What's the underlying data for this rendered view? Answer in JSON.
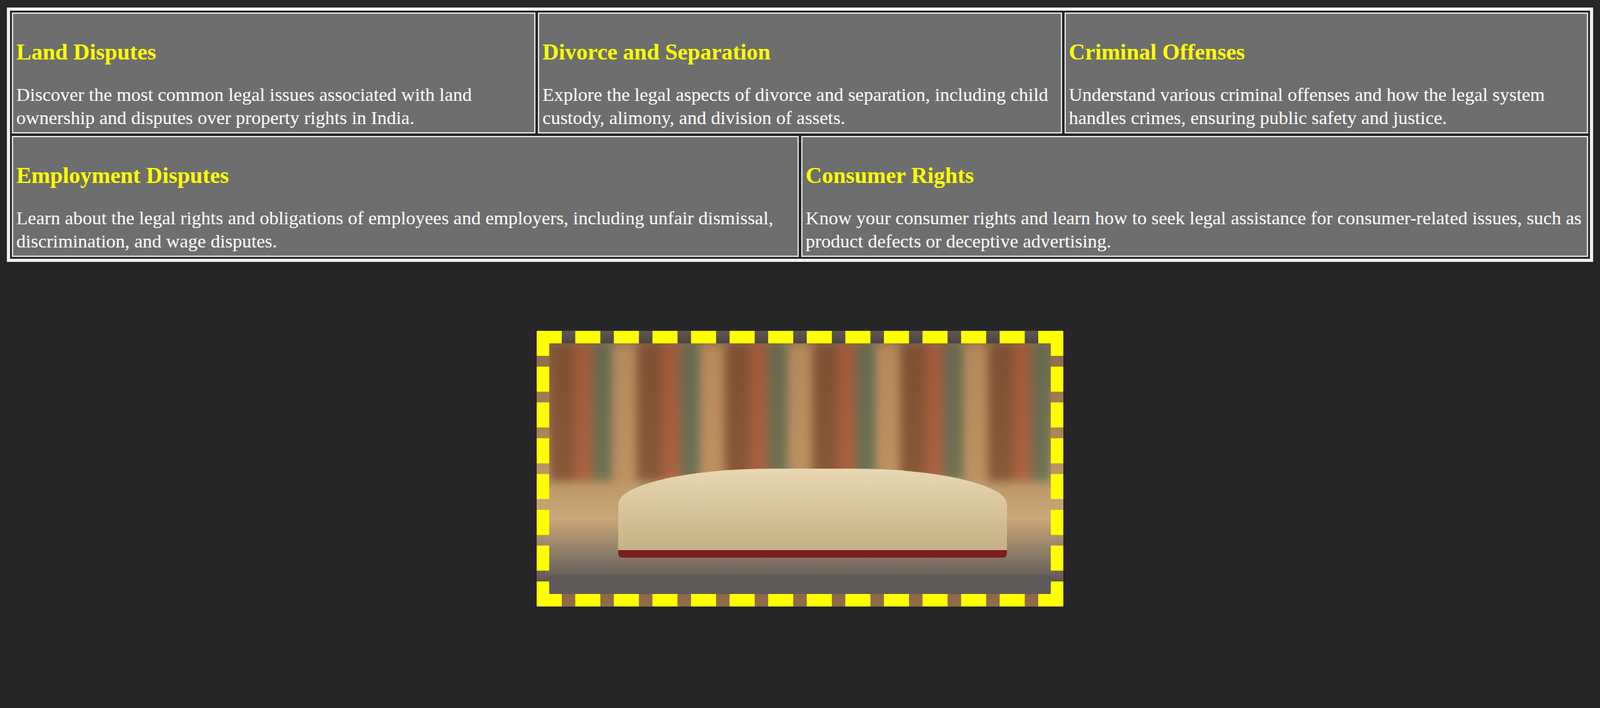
{
  "rows": [
    {
      "cards": [
        {
          "title": "Land Disputes",
          "description": "Discover the most common legal issues associated with land ownership and disputes over property rights in India."
        },
        {
          "title": "Divorce and Separation",
          "description": "Explore the legal aspects of divorce and separation, including child custody, alimony, and division of assets."
        },
        {
          "title": "Criminal Offenses",
          "description": "Understand various criminal offenses and how the legal system handles crimes, ensuring public safety and justice."
        }
      ]
    },
    {
      "cards": [
        {
          "title": "Employment Disputes",
          "description": "Learn about the legal rights and obligations of employees and employers, including unfair dismissal, discrimination, and wage disputes."
        },
        {
          "title": "Consumer Rights",
          "description": "Know your consumer rights and learn how to seek legal assistance for consumer-related issues, such as product defects or deceptive advertising."
        }
      ]
    }
  ]
}
